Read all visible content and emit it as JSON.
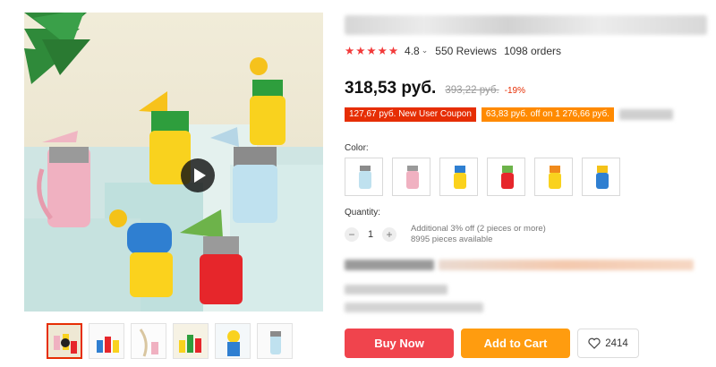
{
  "product": {
    "rating": "4.8",
    "reviews": "550 Reviews",
    "orders": "1098 orders",
    "price": "318,53 руб.",
    "old_price": "393,22 руб.",
    "discount": "-19%"
  },
  "coupons": {
    "new_user": "127,67 руб. New User Coupon",
    "spend_offer": "63,83 руб. off on 1 276,66 руб."
  },
  "color": {
    "label": "Color:",
    "options": [
      "light-blue",
      "pink",
      "yellow-blue",
      "red-green",
      "yellow-orange",
      "blue-yellow"
    ]
  },
  "quantity": {
    "label": "Quantity:",
    "minus": "−",
    "value": "1",
    "plus": "+",
    "info_line1": "Additional 3% off (2 pieces or more)",
    "info_line2": "8995 pieces available"
  },
  "actions": {
    "buy_now": "Buy Now",
    "add_to_cart": "Add to Cart",
    "wishlist_count": "2414"
  },
  "icons": {
    "star": "star-icon",
    "chevron": "chevron-down-icon",
    "play": "play-icon",
    "heart": "heart-icon"
  },
  "colors": {
    "price_red": "#e62e04",
    "buy_button": "#f0444d",
    "cart_button": "#ff9c0f",
    "star_red": "#f23a3a"
  }
}
